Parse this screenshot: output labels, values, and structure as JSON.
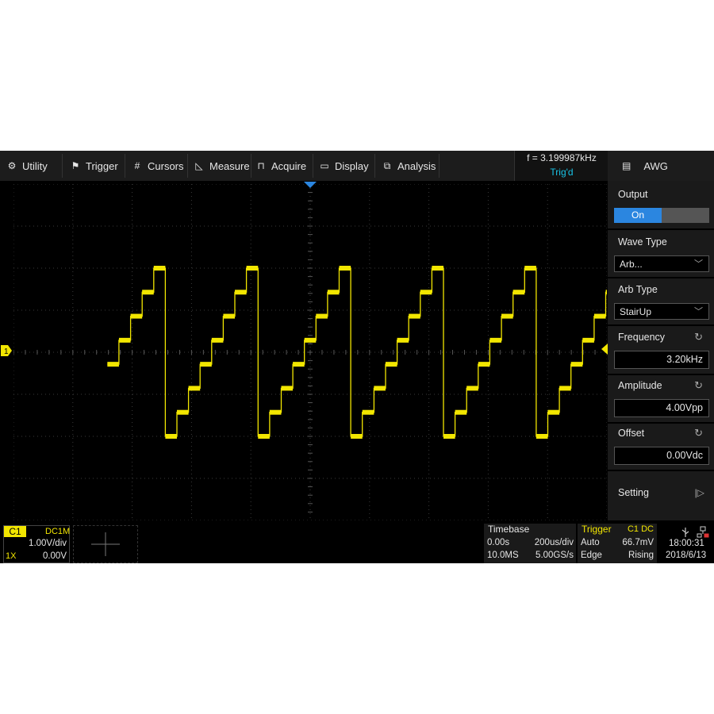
{
  "menu": {
    "items": [
      {
        "label": "Utility",
        "icon": "gear-icon"
      },
      {
        "label": "Trigger",
        "icon": "flag-icon"
      },
      {
        "label": "Cursors",
        "icon": "crosshair-icon"
      },
      {
        "label": "Measure",
        "icon": "ruler-icon"
      },
      {
        "label": "Acquire",
        "icon": "acquire-icon"
      },
      {
        "label": "Display",
        "icon": "monitor-icon"
      },
      {
        "label": "Analysis",
        "icon": "analysis-icon"
      }
    ],
    "frequency": "f = 3.199987kHz",
    "trig_status": "Trig'd"
  },
  "awg": {
    "title": "AWG",
    "output_label": "Output",
    "output_state": "On",
    "wave_type_label": "Wave Type",
    "wave_type_value": "Arb...",
    "arb_type_label": "Arb Type",
    "arb_type_value": "StairUp",
    "frequency_label": "Frequency",
    "frequency_value": "3.20kHz",
    "amplitude_label": "Amplitude",
    "amplitude_value": "4.00Vpp",
    "offset_label": "Offset",
    "offset_value": "0.00Vdc",
    "setting_label": "Setting"
  },
  "channel": {
    "tag": "C1",
    "coupling": "DC1M",
    "scale": "1.00V/div",
    "probe": "1X",
    "offset": "0.00V",
    "marker": "1"
  },
  "timebase": {
    "title": "Timebase",
    "delay": "0.00s",
    "scale": "200us/div",
    "memory": "10.0MS",
    "sample_rate": "5.00GS/s"
  },
  "trigger": {
    "title": "Trigger",
    "source": "C1 DC",
    "mode": "Auto",
    "level": "66.7mV",
    "type": "Edge",
    "slope": "Rising"
  },
  "clock": {
    "time": "18:00:31",
    "date": "2018/6/13"
  },
  "waveform": {
    "type": "staircase-up",
    "steps": 8,
    "periods_visible": 6.4,
    "amplitude_divs": 4,
    "color": "#f2e600"
  },
  "colors": {
    "trace": "#f2e600",
    "accent": "#2b86e0",
    "trig_status": "#19c3e6"
  }
}
